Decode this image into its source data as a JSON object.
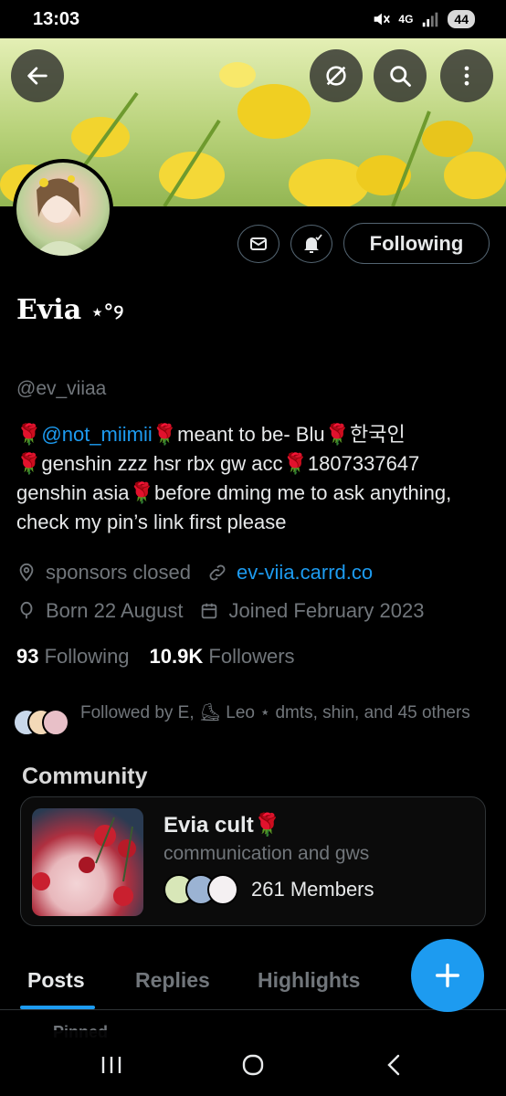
{
  "status_bar": {
    "time": "13:03",
    "network": "4G",
    "battery": "44"
  },
  "header": {
    "back_icon": "arrow-left-icon",
    "grok_icon": "grok-icon",
    "search_icon": "search-icon",
    "more_icon": "more-vertical-icon"
  },
  "profile": {
    "name": "Evia",
    "name_decoration": "⋆°୨",
    "handle": "@ev_viiaa",
    "bio": {
      "mention": "@not_miimii",
      "part1": "meant to be- Blu",
      "part2": "한국인",
      "part3": "genshin zzz hsr rbx gw acc",
      "part4": "1807337647 genshin asia",
      "part5": "before dming me to ask anything, check my pin’s link first please",
      "rose": "🌹"
    },
    "location": "sponsors closed",
    "website": "ev-viia.carrd.co",
    "birthday": "Born 22 August",
    "joined": "Joined February 2023",
    "following_count": "93",
    "following_label": "Following",
    "followers_count": "10.9K",
    "followers_label": "Followers",
    "followed_by": "Followed by E, ⛸ Leo ⋆ dmts, shin, and 45 others",
    "follow_button": "Following"
  },
  "community": {
    "section_title": "Community",
    "name": "Evia cult",
    "description": "communication and gws",
    "members": "261 Members"
  },
  "tabs": [
    {
      "label": "Posts",
      "active": true
    },
    {
      "label": "Replies",
      "active": false
    },
    {
      "label": "Highlights",
      "active": false
    }
  ],
  "pinned_label": "Pinned",
  "colors": {
    "accent": "#1d9bf0",
    "muted": "#71767b",
    "text": "#e7e9ea",
    "rose": "#e0245e"
  }
}
